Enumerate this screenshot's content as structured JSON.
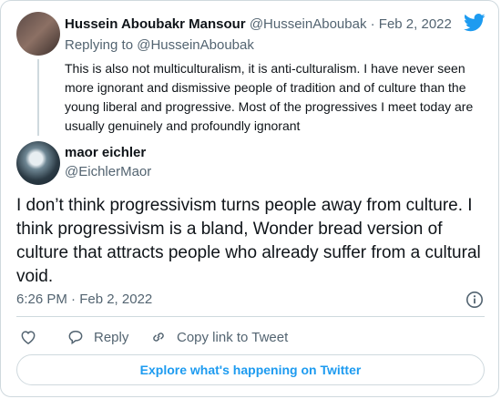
{
  "colors": {
    "accent": "#1d9bf0",
    "text": "#0f1419",
    "secondary": "#536471",
    "border": "#cfd9de"
  },
  "parent_tweet": {
    "author_name": "Hussein Aboubakr Mansour",
    "author_handle": "@HusseinAboubak",
    "separator": " · ",
    "date": "Feb 2, 2022",
    "replying_label": "Replying to ",
    "replying_handle": "@HusseinAboubak",
    "text": "This is also not multiculturalism, it is anti-culturalism. I have never seen more ignorant and dismissive people of tradition and of culture than the young liberal and progressive. Most of the progressives I meet today are usually genuinely and profoundly ignorant"
  },
  "main_tweet": {
    "author_name": "maor eichler",
    "author_handle": "@EichlerMaor",
    "text": "I don’t think progressivism turns people away from culture. I think progressivism is a bland, Wonder bread version of culture that attracts people who already suffer from a cultural void.",
    "timestamp": "6:26 PM · Feb 2, 2022"
  },
  "actions": {
    "like_icon": "heart-icon",
    "reply_label": "Reply",
    "copy_label": "Copy link to Tweet"
  },
  "explore_label": "Explore what's happening on Twitter"
}
